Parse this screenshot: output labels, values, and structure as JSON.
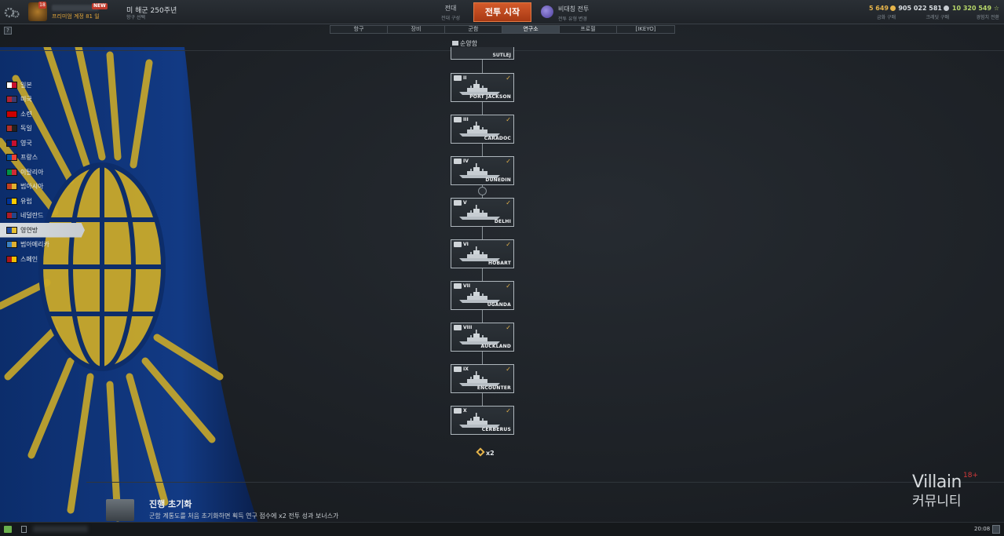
{
  "header": {
    "premium_label": "프리미엄 계정 81 일",
    "new_badge": "NEW",
    "level_badge": "18",
    "port_title": "미 해군 250주년",
    "port_sub": "항구 선택",
    "division_label": "전대",
    "division_sub": "전대 구성",
    "battle_button": "전투 시작",
    "mode_label": "비대칭 전투",
    "mode_sub": "전투 유형 변경",
    "currencies": [
      {
        "value": "5 649",
        "label": "금화 구매",
        "color": "#e6b44a"
      },
      {
        "value": "905 022 581",
        "label": "크레딧 구매",
        "color": "#d9dee2"
      },
      {
        "value": "10 320 549",
        "label": "경험치 전환",
        "color": "#b8d86a"
      }
    ]
  },
  "help_label": "?",
  "tabs": [
    "항구",
    "장비",
    "군함",
    "연구소",
    "프로필",
    "[IKEYO]"
  ],
  "active_tab": "연구소",
  "nations": [
    {
      "label": "일본",
      "colors": [
        "#ffffff",
        "#c8102e"
      ]
    },
    {
      "label": "미국",
      "colors": [
        "#b22234",
        "#3c3b6e"
      ]
    },
    {
      "label": "소련",
      "colors": [
        "#cc0000",
        "#cc0000"
      ]
    },
    {
      "label": "독일",
      "colors": [
        "#b0302a",
        "#222222"
      ]
    },
    {
      "label": "영국",
      "colors": [
        "#012169",
        "#c8102e"
      ]
    },
    {
      "label": "프랑스",
      "colors": [
        "#0055a4",
        "#ef4135"
      ]
    },
    {
      "label": "이탈리아",
      "colors": [
        "#009246",
        "#ce2b37"
      ]
    },
    {
      "label": "범아시아",
      "colors": [
        "#c04020",
        "#e0b030"
      ]
    },
    {
      "label": "유럽",
      "colors": [
        "#003399",
        "#ffcc00"
      ]
    },
    {
      "label": "네덜란드",
      "colors": [
        "#ae1c28",
        "#21468b"
      ]
    },
    {
      "label": "영연방",
      "colors": [
        "#1f4aa0",
        "#e6c031"
      ]
    },
    {
      "label": "범아메리카",
      "colors": [
        "#3a7fc2",
        "#e0b030"
      ]
    },
    {
      "label": "스페인",
      "colors": [
        "#aa151b",
        "#f1bf00"
      ]
    }
  ],
  "active_nation": "영연방",
  "tree": {
    "title": "순양함",
    "top_ship": "SUTLEJ",
    "ships": [
      {
        "tier": "II",
        "name": "PORT JACKSON",
        "researched": true
      },
      {
        "tier": "III",
        "name": "CARADOC",
        "researched": true
      },
      {
        "tier": "IV",
        "name": "DUNEDIN",
        "researched": true
      },
      {
        "tier": "V",
        "name": "DELHI",
        "researched": true
      },
      {
        "tier": "VI",
        "name": "HOBART",
        "researched": true
      },
      {
        "tier": "VII",
        "name": "UGANDA",
        "researched": true
      },
      {
        "tier": "VIII",
        "name": "AUCKLAND",
        "researched": true
      },
      {
        "tier": "IX",
        "name": "ENCOUNTER",
        "researched": true
      },
      {
        "tier": "X",
        "name": "CERBERUS",
        "researched": true
      }
    ],
    "check_mark": "✓",
    "bonus_label": "x2"
  },
  "reset": {
    "title": "진행 초기화",
    "description": "군함 계통도를 처음 초기화하면 획득 연구 점수에 x2 전투 성과 보너스가"
  },
  "watermark": {
    "line1": "Villain",
    "line2": "커뮤니티",
    "age": "18+"
  },
  "status": {
    "clock": "20:08"
  }
}
